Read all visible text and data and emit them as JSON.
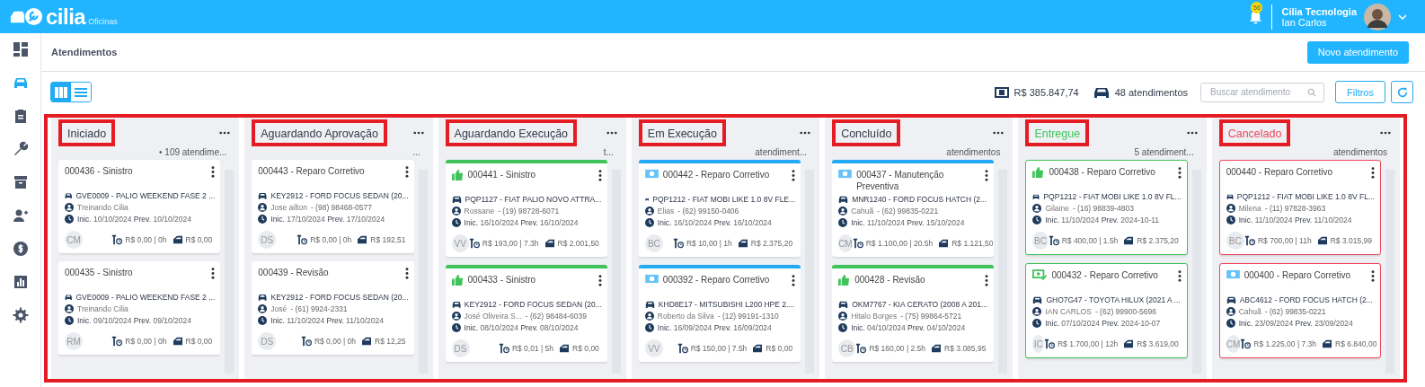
{
  "topbar": {
    "brand": "cilia",
    "product": "Oficinas",
    "notifications": "56",
    "company": "Cilia Tecnologia",
    "user": "Ian Carlos"
  },
  "sidebar": {
    "items": [
      {
        "selected": false
      },
      {
        "selected": true
      },
      {
        "selected": false
      },
      {
        "selected": false
      },
      {
        "selected": false
      },
      {
        "selected": false
      },
      {
        "selected": false
      },
      {
        "selected": false
      },
      {
        "selected": false
      }
    ]
  },
  "page": {
    "title": "Atendimentos",
    "new_button": "Novo atendimento"
  },
  "toolbar": {
    "views": [
      {
        "selected": true
      },
      {
        "selected": false
      }
    ],
    "total": "R$ 385.847,74",
    "count": "48 atendimentos",
    "search": {
      "placeholder": "Buscar atendimento"
    },
    "filters": "Filtros"
  },
  "columns": [
    {
      "title": "Iniciado",
      "color": "#333b4a",
      "subtitle": "• 109 atendime...",
      "cards": [
        {
          "title": "000436 - Sinistro",
          "kind": "plain",
          "vehicle": "GVE0009 - PALIO WEEKEND FASE 2 ...",
          "client": "Treinando Cilia",
          "dates": "**Inic.** 10/10/2024 **Prev.** 10/10/2024",
          "initials": "CM",
          "labor": "R$ 0,00 | 0h",
          "parts": "R$ 0,00"
        },
        {
          "title": "000435 - Sinistro",
          "kind": "plain",
          "vehicle": "GVE0009 - PALIO WEEKEND FASE 2 ...",
          "client": "Treinando Cilia",
          "dates": "**Inic.** 09/10/2024 **Prev.** 09/10/2024",
          "initials": "RM",
          "labor": "R$ 0,00 | 0h",
          "parts": "R$ 0,00"
        }
      ]
    },
    {
      "title": "Aguardando Aprovação",
      "color": "#333b4a",
      "subtitle": "...",
      "cards": [
        {
          "title": "000443 - Reparo Corretivo",
          "kind": "plain",
          "vehicle": "KEY2912 - FORD FOCUS SEDAN (20...",
          "client": "Jose ailton",
          "phone": "- (98) 98468-0577",
          "dates": "**Inic.** 17/10/2024 **Prev.** 17/10/2024",
          "initials": "DS",
          "labor": "R$ 0,00 | 0h",
          "parts": "R$ 192,51"
        },
        {
          "title": "000439 - Revisão",
          "kind": "plain",
          "vehicle": "KEY2912 - FORD FOCUS SEDAN (20...",
          "client": "José",
          "phone": "- (61) 9924-2331",
          "dates": "**Inic.** 11/10/2024 **Prev.** 11/10/2024",
          "initials": "DS",
          "labor": "R$ 0,00 | 0h",
          "parts": "R$ 12,25"
        }
      ]
    },
    {
      "title": "Aguardando Execução",
      "color": "#333b4a",
      "subtitle": "t...",
      "cards": [
        {
          "title": "000441 - Sinistro",
          "kind": "thumb",
          "outline": false,
          "color": "#3ec45a",
          "vehicle": "PQP1127 - FIAT PALIO NOVO ATTRA...",
          "client": "Rossane",
          "phone": "- (19) 98728-6071",
          "dates": "**Inic.** 16/10/2024 **Prev.** 16/10/2024",
          "initials": "VV",
          "labor": "R$ 193,00 | 7.3h",
          "parts": "R$ 2.001,50"
        },
        {
          "title": "000433 - Sinistro",
          "kind": "thumb",
          "outline": false,
          "color": "#3ec45a",
          "vehicle": "KEY2912 - FORD FOCUS SEDAN (20...",
          "client": "José Oliveira S...",
          "phone": "- (62) 98484-6039",
          "dates": "**Inic.** 08/10/2024 **Prev.** 08/10/2024",
          "initials": "DS",
          "labor": "R$ 0,01 | 5h",
          "parts": "R$ 0,00"
        }
      ]
    },
    {
      "title": "Em Execução",
      "color": "#333b4a",
      "subtitle": "atendiment...",
      "cards": [
        {
          "title": "000442 - Reparo Corretivo",
          "kind": "card",
          "outline": false,
          "color": "#22aaf5",
          "vehicle": "PQP1212 - FIAT MOBI LIKE 1.0 8V FLE...",
          "client": "Elias",
          "phone": "- (62) 99150-0406",
          "dates": "**Inic.** 16/10/2024 **Prev.** 16/10/2024",
          "initials": "BC",
          "labor": "R$ 10,00 | 1h",
          "parts": "R$ 2.375,20"
        },
        {
          "title": "000392 - Reparo Corretivo",
          "kind": "card",
          "outline": false,
          "color": "#22aaf5",
          "vehicle": "KHD8E17 - MITSUBISHI L200 HPE 2....",
          "client": "Roberto da Silva",
          "phone": "- (12) 99191-1310",
          "dates": "**Inic.** 16/09/2024 **Prev.** 16/09/2024",
          "initials": "VV",
          "labor": "R$ 150,00 | 7.5h",
          "parts": "R$ 0,00"
        }
      ]
    },
    {
      "title": "Concluído",
      "color": "#333b4a",
      "subtitle": "atendimentos",
      "cards": [
        {
          "title": "000437 - Manutenção Preventiva",
          "kind": "card",
          "outline": false,
          "color": "#22aaf5",
          "vehicle": "MNR1240 - FORD FOCUS HATCH (2...",
          "client": "Cahuã",
          "phone": "- (62) 99835-0221",
          "dates": "**Inic.** 11/10/2024 **Prev.** 15/10/2024",
          "initials": "CM",
          "labor": "R$ 1.100,00 | 20.5h",
          "parts": "R$ 1.121,50"
        },
        {
          "title": "000428 - Revisão",
          "kind": "thumb",
          "outline": false,
          "color": "#3ec45a",
          "vehicle": "OKM7767 - KIA CERATO (2008 A 201...",
          "client": "Hitalo Borges",
          "phone": "- (75) 99864-5721",
          "dates": "**Inic.** 04/10/2024 **Prev.** 04/10/2024",
          "initials": "CB",
          "labor": "R$ 160,00 | 2.5h",
          "parts": "R$ 3.085,95"
        }
      ]
    },
    {
      "title": "Entregue",
      "color": "#3ec45a",
      "subtitle": "5 atendiment...",
      "cards": [
        {
          "title": "000438 - Reparo Corretivo",
          "kind": "thumb",
          "outline": true,
          "color": "#3ec45a",
          "vehicle": "PQP1212 - FIAT MOBI LIKE 1.0 8V FL...",
          "client": "Gilaine",
          "phone": "- (16) 98839-4803",
          "dates": "**Inic.** 11/10/2024 **Prev.** 2024-10-11",
          "initials": "BC",
          "labor": "R$ 400,00 | 1.5h",
          "parts": "R$ 2.375,20"
        },
        {
          "title": "000432 - Reparo Corretivo",
          "kind": "cash",
          "outline": true,
          "color": "#3ec45a",
          "vehicle": "GHO7G47 - TOYOTA HILUX (2021 A ...",
          "client": "IAN CARLOS",
          "phone": "- (62) 99900-5696",
          "dates": "**Inic.** 07/10/2024 **Prev.** 2024-10-07",
          "initials": "IC",
          "labor": "R$ 1.700,00 | 12h",
          "parts": "R$ 3.619,00"
        }
      ]
    },
    {
      "title": "Cancelado",
      "color": "#f0475a",
      "subtitle": "atendimentos",
      "cards": [
        {
          "title": "000440 - Reparo Corretivo",
          "kind": "plain",
          "outline": true,
          "color": "#f0475a",
          "vehicle": "PQP1212 - FIAT MOBI LIKE 1.0 8V FL...",
          "client": "Milena",
          "phone": "- (11) 97828-3963",
          "dates": "**Inic.** 11/10/2024 **Prev.** 11/10/2024",
          "initials": "BC",
          "labor": "R$ 700,00 | 11h",
          "parts": "R$ 3.015,99"
        },
        {
          "title": "000400 - Reparo Corretivo",
          "kind": "card",
          "outline": true,
          "color": "#f0475a",
          "vehicle": "ABC4612 - FORD FOCUS HATCH (2...",
          "client": "Cahuã",
          "phone": "- (62) 99835-0221",
          "dates": "**Inic.** 23/09/2024 **Prev.** 23/09/2024",
          "initials": "CM",
          "labor": "R$ 1.225,00 | 7.3h",
          "parts": "R$ 6.840,00"
        }
      ]
    }
  ]
}
